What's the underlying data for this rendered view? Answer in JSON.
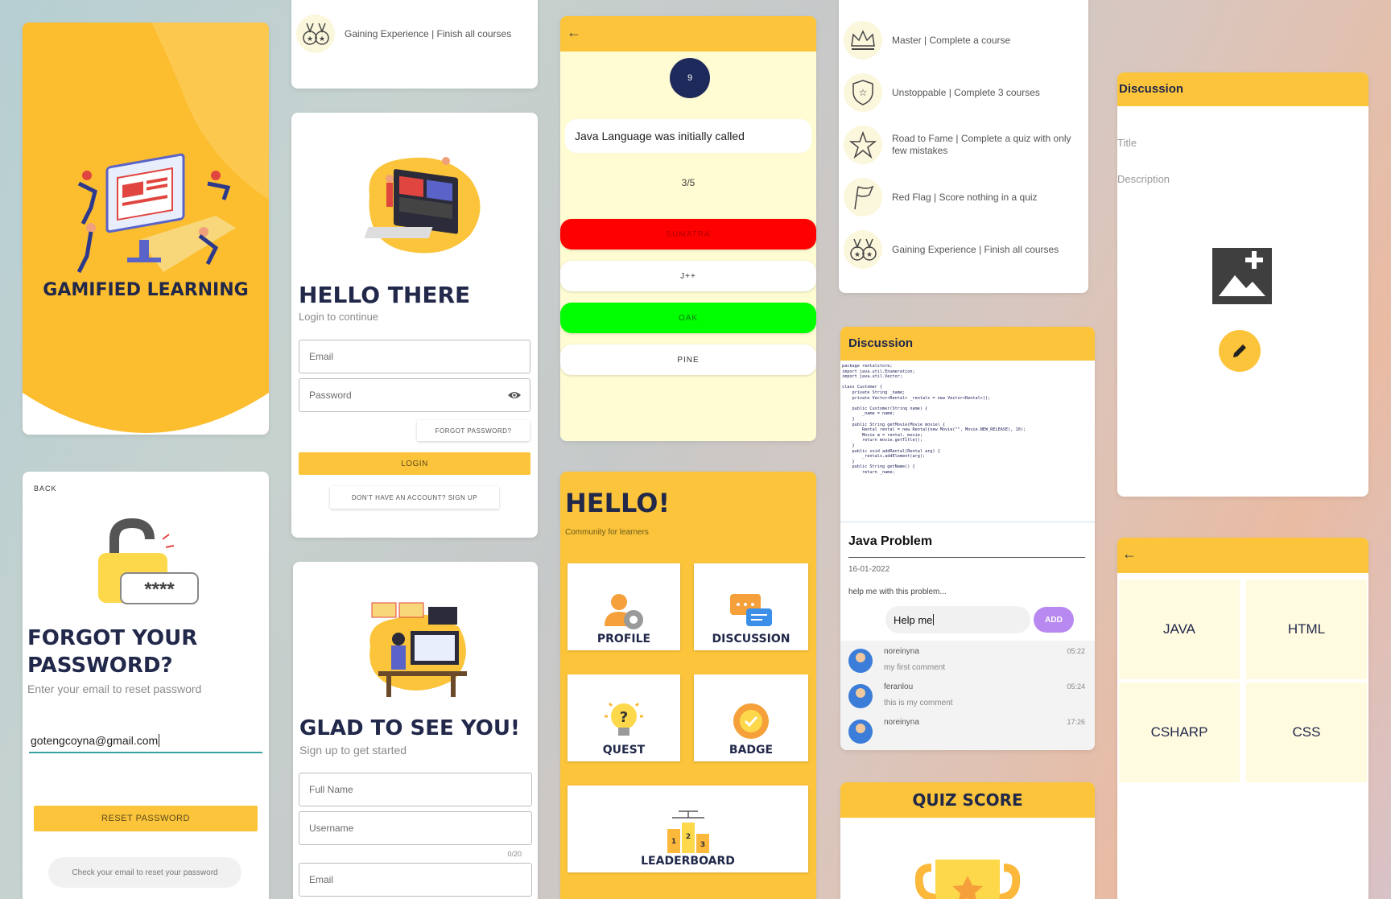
{
  "splash": {
    "title": "GAMIFIED LEARNING",
    "colors": {
      "bg": "#fcbd2f"
    }
  },
  "badges_top": {
    "items": [
      {
        "icon": "medals-icon",
        "label": "Gaining Experience | Finish all courses"
      }
    ]
  },
  "login": {
    "title": "HELLO THERE",
    "subtitle": "Login to continue",
    "email_placeholder": "Email",
    "password_placeholder": "Password",
    "forgot_label": "FORGOT PASSWORD?",
    "login_label": "LOGIN",
    "signup_label": "DON'T HAVE AN ACCOUNT? SIGN UP"
  },
  "quiz": {
    "question_number": "9",
    "question": "Java Language was initially called",
    "progress": "3/5",
    "answers": [
      {
        "label": "SUMATRA",
        "state": "wrong",
        "color": "#ff0000"
      },
      {
        "label": "J++",
        "state": "neutral",
        "color": "#ffffff"
      },
      {
        "label": "OAK",
        "state": "correct",
        "color": "#00ff00"
      },
      {
        "label": "PINE",
        "state": "neutral",
        "color": "#ffffff"
      }
    ]
  },
  "badges": {
    "items": [
      {
        "icon": "crown-icon",
        "label": "Master | Complete a course"
      },
      {
        "icon": "shield-star-icon",
        "label": "Unstoppable | Complete 3 courses"
      },
      {
        "icon": "star-icon",
        "label": "Road to Fame | Complete a quiz with only few mistakes"
      },
      {
        "icon": "flag-icon",
        "label": "Red Flag | Score nothing in a quiz"
      },
      {
        "icon": "medals-icon",
        "label": "Gaining Experience | Finish all courses"
      }
    ]
  },
  "discussion_form": {
    "header": "Discussion",
    "title_placeholder": "Title",
    "description_placeholder": "Description"
  },
  "forgot": {
    "back": "BACK",
    "title_line1": "FORGOT YOUR",
    "title_line2": "PASSWORD?",
    "subtitle": "Enter your email to reset password",
    "email_value": "gotengcoyna@gmail.com",
    "reset_label": "RESET PASSWORD",
    "hint": "Check your email to reset your password",
    "lock_stars": "****"
  },
  "signup": {
    "title": "GLAD TO SEE YOU!",
    "subtitle": "Sign up to get started",
    "fullname_placeholder": "Full Name",
    "username_placeholder": "Username",
    "counter": "0/20",
    "email_placeholder": "Email"
  },
  "home": {
    "title": "HELLO!",
    "subtitle": "Community for learners",
    "tiles": {
      "profile": "PROFILE",
      "discussion": "DISCUSSION",
      "quest": "QUEST",
      "badge": "BADGE",
      "leaderboard": "LEADERBOARD"
    }
  },
  "discussion_detail": {
    "header": "Discussion",
    "code_lines": [
      "package rentalstore;",
      "import java.util.Enumeration;",
      "import java.util.Vector;",
      "",
      "class Customer {",
      "    private String _name;",
      "    private Vector<Rental> _rentals = new Vector<Rental>();",
      "",
      "    public Customer(String name) {",
      "        _name = name;",
      "    }",
      "    public String getMovie(Movie movie) {",
      "        Rental rental = new Rental(new Movie(\"\", Movie.NEW_RELEASE), 10);",
      "        Movie m = rental._movie;",
      "        return movie.getTitle();",
      "    }",
      "    public void addRental(Rental arg) {",
      "        _rentals.addElement(arg);",
      "    }",
      "    public String getName() {",
      "        return _name;"
    ],
    "title": "Java Problem",
    "date": "16-01-2022",
    "body": "help me with this problem...",
    "comment_input": "Help me",
    "add_label": "ADD",
    "comments": [
      {
        "user": "noreinyna",
        "text": "my first comment",
        "time": "05:22"
      },
      {
        "user": "feranlou",
        "text": "this is my comment",
        "time": "05:24"
      },
      {
        "user": "noreinyna",
        "text": "",
        "time": "17:26"
      }
    ]
  },
  "quiz_score": {
    "title": "QUIZ SCORE"
  },
  "courses": {
    "items": [
      "JAVA",
      "HTML",
      "CSHARP",
      "CSS"
    ]
  },
  "accent": {
    "yellow": "#fbc43a",
    "navy": "#21284a",
    "purple": "#b889f0"
  }
}
